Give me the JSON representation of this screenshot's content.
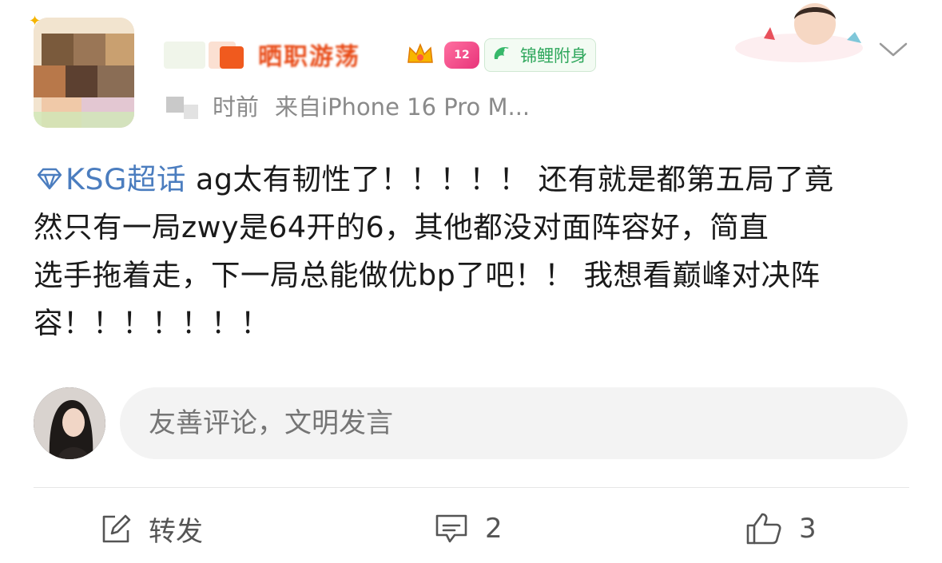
{
  "post": {
    "author": {
      "name_visible_fragment": "晒职游荡"
    },
    "badges": {
      "level": "12",
      "koi_label": "锦鲤附身"
    },
    "meta": {
      "time_fragment": "时前",
      "source": "来自iPhone 16 Pro M..."
    },
    "content": {
      "topic": "KSG超话",
      "line1": " ag太有韧性了！！！！！ 还有就是都第五局了竟",
      "line2": "然只有一局zwy是64开的6，其他都没对面阵容好，简直",
      "line3": "选手拖着走，下一局总能做优bp了吧！！ 我想看巅峰对决阵",
      "line4": "容！！！！！！！"
    },
    "topic_color": "#4b7dbf"
  },
  "comment_box": {
    "placeholder": "友善评论，文明发言"
  },
  "actions": {
    "repost_label": "转发",
    "comment_count": "2",
    "like_count": "3"
  },
  "icons": {
    "chevron": "chevron-down-icon",
    "repost": "edit-share-icon",
    "comment": "comment-bubble-icon",
    "like": "thumbs-up-icon",
    "topic": "diamond-icon"
  }
}
